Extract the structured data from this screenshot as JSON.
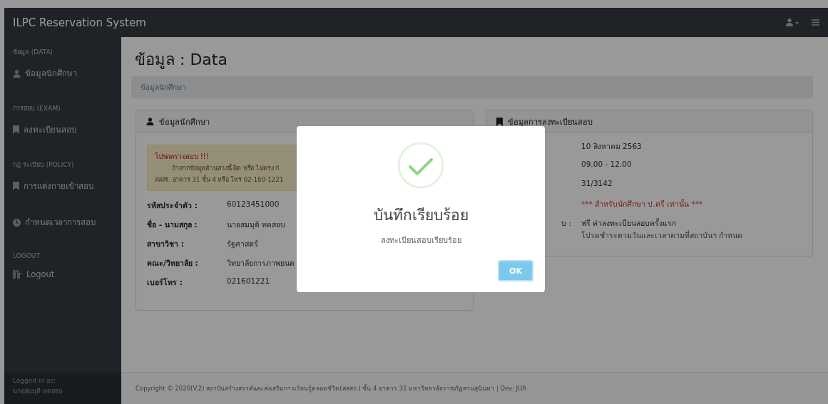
{
  "navbar": {
    "brand": "ILPC Reservation System"
  },
  "sidebar": {
    "sections": [
      {
        "heading": "ข้อมูล (DATA)",
        "items": [
          {
            "label": "ข้อมูลนักศึกษา"
          }
        ]
      },
      {
        "heading": "การสอบ (EXAM)",
        "items": [
          {
            "label": "ลงทะเบียนสอบ"
          }
        ]
      },
      {
        "heading": "กฎ ระเบียบ (POLICY)",
        "items": [
          {
            "label": "การแต่งกายเข้าสอบ"
          },
          {
            "label": "กำหนดเวลาการสอบ"
          }
        ]
      },
      {
        "heading": "LOGOUT",
        "items": [
          {
            "label": "Logout"
          }
        ]
      }
    ],
    "logged_in": {
      "label": "Logged in as:",
      "user": "นายสมมุติ ทดสอบ"
    }
  },
  "page": {
    "title": "ข้อมูล : Data",
    "breadcrumb": "ข้อมูลนักศึกษา"
  },
  "student_card": {
    "title": "ข้อมูลนักศึกษา",
    "alert": {
      "title": "โปรดตรวจสอบ !!!",
      "lines": [
        "ถ้าหากข้อมูลด้านล่างนี้ ผิด หรือ ไม่ตรง กั",
        "สสสร. อาคาร 31 ชั้น 4 หรือ โทร 02-160-1221"
      ]
    },
    "fields": [
      {
        "label": "รหัสประจำตัว :",
        "value": "60123451000"
      },
      {
        "label": "ชื่อ - นามสกุล :",
        "value": "นายสมมุติ ทดสอบ"
      },
      {
        "label": "สาขาวิชา :",
        "value": "รัฐศาสตร์"
      },
      {
        "label": "คณะ/วิทยาลัย :",
        "value": "วิทยาลัยการภาพยนต"
      },
      {
        "label": "เบอร์โทร :",
        "value": "021601221"
      }
    ]
  },
  "exam_card": {
    "title": "ข้อมูลการลงทะเบียนสอบ",
    "fields": [
      {
        "kind": "plain",
        "value": "10 สิงหาคม 2563"
      },
      {
        "kind": "plain",
        "value": "09.00 - 12.00"
      },
      {
        "kind": "plain",
        "value": "31/3142"
      },
      {
        "kind": "warning",
        "value": "*** สำหรับนักศึกษา ป.ตรี เท่านั้น ***"
      },
      {
        "kind": "plain",
        "label": "บ :",
        "value": "ฟรี ค่าลงทะเบียนสอบครั้งแรก",
        "note": "โปรดชำระตามวันและเวลาตามที่สถาบันฯ กำหนด"
      }
    ]
  },
  "footer": {
    "text": "Copyright © 2020(V.2) สถาบันสร้างสรรค์และส่งเสริมการเรียนรู้ตลอดชีวิต(สสสร.) ชั้น 4 อาคาร 31 มหาวิทยาลัยราชภัฏสวนสุนันทา | Dev: JUA"
  },
  "dialog": {
    "title": "บันทึกเรียบร้อย",
    "message": "ลงทะเบียนสอบเรียบร้อย",
    "button": "OK"
  }
}
